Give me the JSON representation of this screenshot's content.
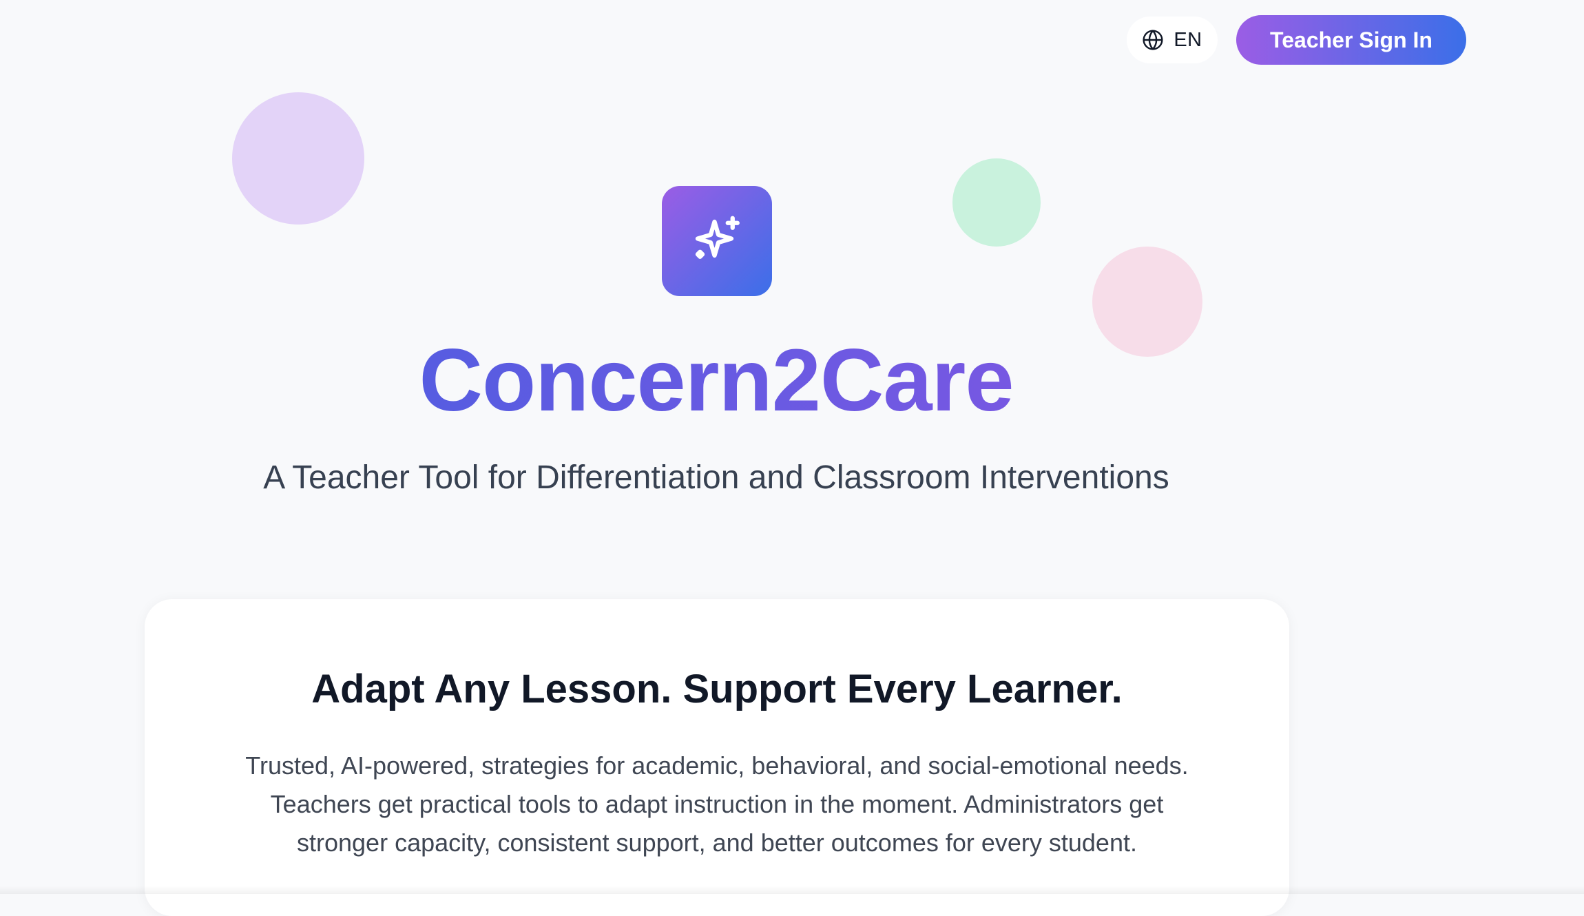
{
  "header": {
    "language": {
      "icon": "globe-icon",
      "label": "EN"
    },
    "sign_in_label": "Teacher Sign In"
  },
  "hero": {
    "logo_icon": "sparkles-icon",
    "title": "Concern2Care",
    "tagline": "A Teacher Tool for Differentiation and Classroom Interventions"
  },
  "card": {
    "heading": "Adapt Any Lesson. Support Every Learner.",
    "body_lines": [
      "Trusted, AI-powered, strategies for academic, behavioral, and social-emotional needs.",
      "Teachers get practical tools to adapt instruction in the moment. Administrators get",
      "stronger capacity, consistent support, and better outcomes for every student."
    ]
  },
  "colors": {
    "background": "#f8f9fb",
    "brand_gradient_start": "#9b5de5",
    "brand_gradient_end": "#3b6fe8",
    "title_gradient_start": "#3f5fe0",
    "title_gradient_end": "#8e55e3",
    "bubble_purple": "#e3d3f8",
    "bubble_green": "#c9f2dd",
    "bubble_pink": "#f7dde9"
  }
}
